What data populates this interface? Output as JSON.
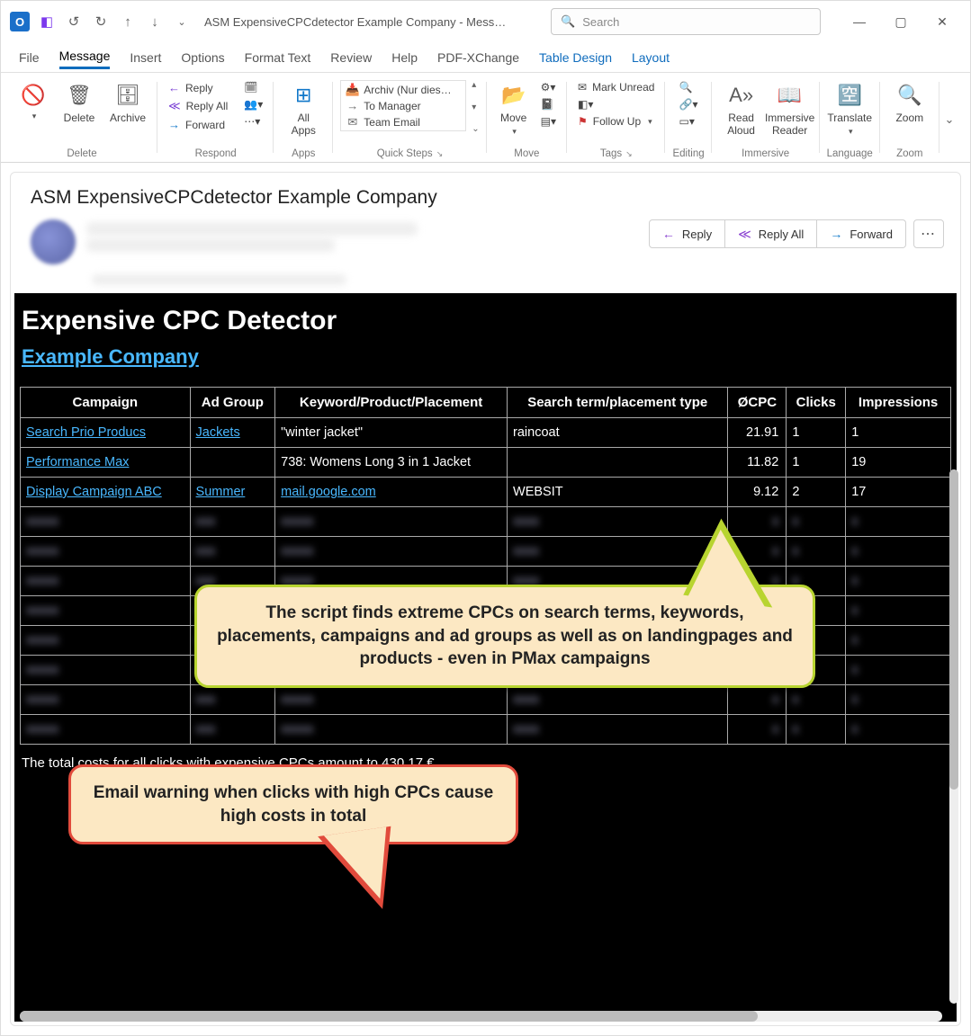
{
  "window": {
    "title": "ASM ExpensiveCPCdetector Example Company  -  Message (HT…",
    "search_placeholder": "Search"
  },
  "tabs": [
    "File",
    "Message",
    "Insert",
    "Options",
    "Format Text",
    "Review",
    "Help",
    "PDF-XChange",
    "Table Design",
    "Layout"
  ],
  "active_tab": "Message",
  "context_tabs": [
    "Table Design",
    "Layout"
  ],
  "ribbon": {
    "delete": {
      "delete": "Delete",
      "archive": "Archive",
      "group": "Delete"
    },
    "respond": {
      "reply": "Reply",
      "reply_all": "Reply All",
      "forward": "Forward",
      "group": "Respond"
    },
    "apps": {
      "all_apps": "All\nApps",
      "group": "Apps"
    },
    "quicksteps": {
      "items": [
        "Archiv (Nur dies…",
        "To Manager",
        "Team Email"
      ],
      "group": "Quick Steps"
    },
    "move": {
      "move": "Move",
      "group": "Move"
    },
    "tags": {
      "unread": "Mark Unread",
      "followup": "Follow Up",
      "group": "Tags"
    },
    "editing": {
      "group": "Editing"
    },
    "immersive": {
      "read_aloud": "Read\nAloud",
      "immersive": "Immersive\nReader",
      "group": "Immersive"
    },
    "language": {
      "translate": "Translate",
      "group": "Language"
    },
    "zoom": {
      "zoom": "Zoom",
      "group": "Zoom"
    }
  },
  "message": {
    "subject": "ASM ExpensiveCPCdetector Example Company",
    "actions": {
      "reply": "Reply",
      "reply_all": "Reply All",
      "forward": "Forward"
    }
  },
  "email": {
    "title": "Expensive CPC Detector",
    "company": "Example Company",
    "columns": [
      "Campaign",
      "Ad Group",
      "Keyword/Product/Placement",
      "Search term/placement type",
      "ØCPC",
      "Clicks",
      "Impressions"
    ],
    "rows": [
      {
        "campaign": "Search Prio Producs",
        "adgroup": "Jackets",
        "kw": "\"winter jacket\"",
        "term": "raincoat",
        "cpc": "21.91",
        "clicks": "1",
        "imp": "1"
      },
      {
        "campaign": "Performance Max",
        "adgroup": "",
        "kw": "738: Womens Long 3 in 1 Jacket",
        "term": "",
        "cpc": "11.82",
        "clicks": "1",
        "imp": "19"
      },
      {
        "campaign": "Display Campaign ABC",
        "adgroup": "Summer",
        "kw": "mail.google.com",
        "term": "WEBSIT",
        "cpc": "9.12",
        "clicks": "2",
        "imp": "17"
      }
    ],
    "total_line": "The total costs for all clicks with expensive CPCs amount to 430.17 €."
  },
  "callouts": {
    "yellow": "The script finds extreme CPCs on search terms, keywords, placements, campaigns and ad groups as well as on landingpages and products - even in PMax campaigns",
    "red": "Email warning when clicks with high CPCs cause high costs in total"
  }
}
